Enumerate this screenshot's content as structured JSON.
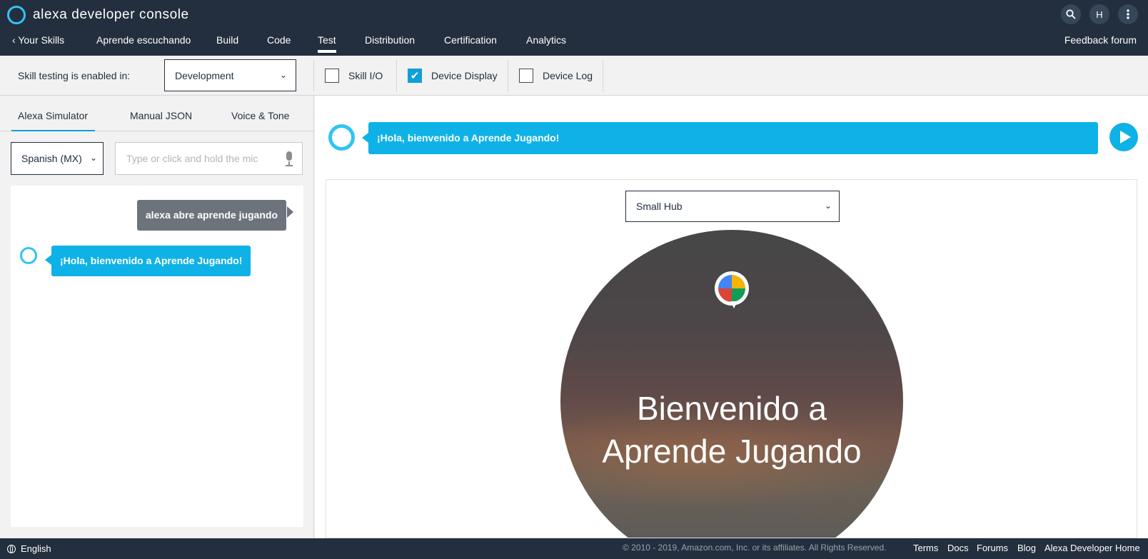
{
  "header": {
    "brand": "alexa developer console",
    "search_icon": "search-icon",
    "avatar_initial": "H",
    "menu_icon": "more-vertical-icon"
  },
  "nav": {
    "back_label": "Your Skills",
    "skill_name": "Aprende escuchando",
    "items": [
      "Build",
      "Code",
      "Test",
      "Distribution",
      "Certification",
      "Analytics"
    ],
    "active": "Test",
    "feedback": "Feedback forum"
  },
  "toolbar": {
    "label": "Skill testing is enabled in:",
    "stage": "Development",
    "skill_io": {
      "label": "Skill I/O",
      "checked": false
    },
    "device_display": {
      "label": "Device Display",
      "checked": true
    },
    "device_log": {
      "label": "Device Log",
      "checked": false
    }
  },
  "left": {
    "tabs": [
      "Alexa Simulator",
      "Manual JSON",
      "Voice & Tone"
    ],
    "active_tab": "Alexa Simulator",
    "language": "Spanish (MX)",
    "utterance_placeholder": "Type or click and hold the mic",
    "utterance_value": "",
    "conversation": {
      "user": "alexa abre aprende jugando",
      "alexa": "¡Hola, bienvenido a Aprende Jugando!"
    }
  },
  "right": {
    "speech": "¡Hola, bienvenido a Aprende Jugando!",
    "device": "Small Hub",
    "display_title": "Bienvenido a Aprende Jugando"
  },
  "footer": {
    "language": "English",
    "copyright": "© 2010 - 2019, Amazon.com, Inc. or its affiliates. All Rights Reserved.",
    "links": [
      "Terms",
      "Docs",
      "Forums",
      "Blog",
      "Alexa Developer Home"
    ]
  },
  "colors": {
    "header_bg": "#232f3e",
    "accent": "#0fb2e6",
    "alexa_ring": "#31c4f3",
    "user_bubble": "#6c737c"
  }
}
